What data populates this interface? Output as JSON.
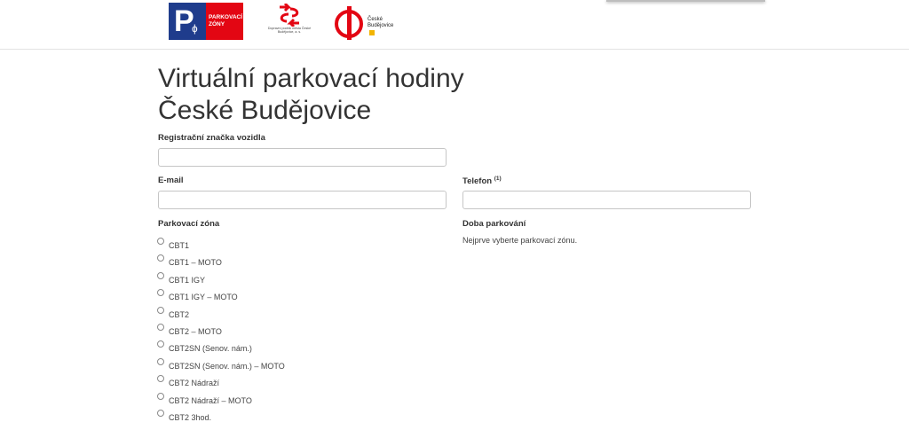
{
  "header": {
    "logo_parkovaci_zony": {
      "text": "PARKOVACÍ ZÓNY",
      "symbol": "P",
      "phi": "ɸ"
    },
    "logo_dopravni_podnik": {
      "caption": "Dopravní podnik města České Budějovice, a. s."
    },
    "logo_ceske_budejovice": {
      "text_line1": "České",
      "text_line2": "Budějovice"
    }
  },
  "page": {
    "title_line1": "Virtuální parkovací hodiny",
    "title_line2": "České Budějovice"
  },
  "form": {
    "registration_label": "Registrační značka vozidla",
    "registration_value": "",
    "email_label": "E-mail",
    "email_value": "",
    "phone_label": "Telefon",
    "phone_note": "(1)",
    "phone_value": "",
    "zone_label": "Parkovací zóna",
    "duration_label": "Doba parkování",
    "duration_hint": "Nejprve vyberte parkovací zónu."
  },
  "zones": [
    {
      "label": "CBT1"
    },
    {
      "label": "CBT1 – MOTO"
    },
    {
      "label": "CBT1 IGY"
    },
    {
      "label": "CBT1 IGY – MOTO"
    },
    {
      "label": "CBT2"
    },
    {
      "label": "CBT2 – MOTO"
    },
    {
      "label": "CBT2SN (Senov. nám.)"
    },
    {
      "label": "CBT2SN (Senov. nám.) – MOTO"
    },
    {
      "label": "CBT2 Nádraží"
    },
    {
      "label": "CBT2 Nádraží – MOTO"
    },
    {
      "label": "CBT2 3hod."
    }
  ],
  "colors": {
    "brand_blue": "#1f3c8c",
    "brand_red": "#e30613",
    "accent_yellow": "#f2b400"
  }
}
